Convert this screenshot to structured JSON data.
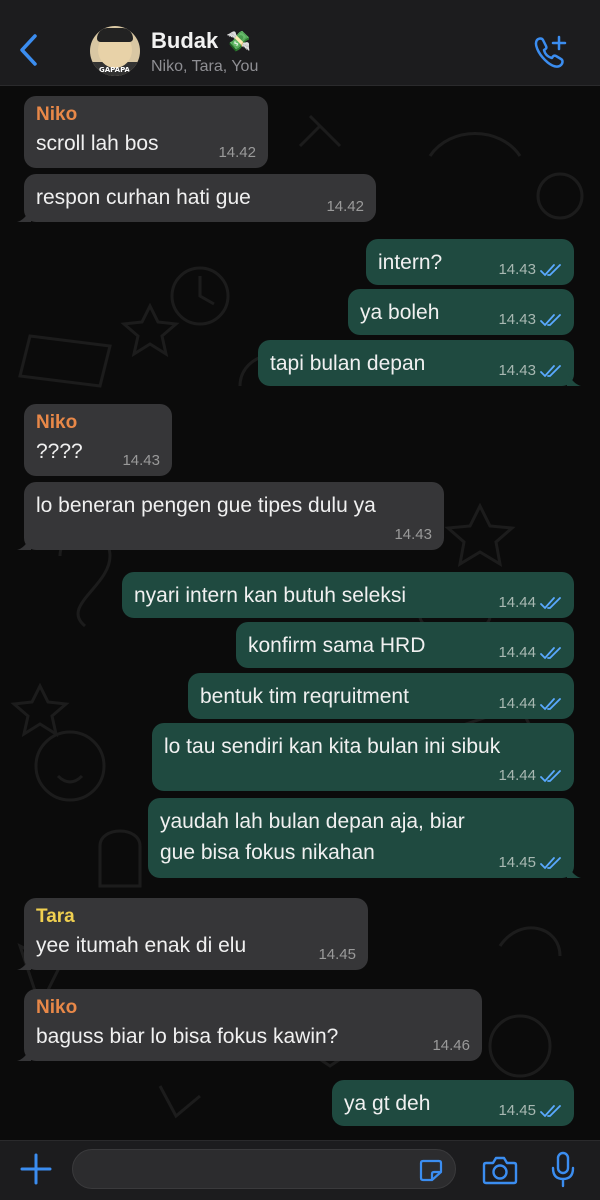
{
  "header": {
    "group_name": "Budak",
    "group_emoji": "💸",
    "members": "Niko, Tara, You",
    "avatar_tag": "GAPAPA"
  },
  "messages": [
    {
      "sender": "Niko",
      "text": "scroll lah bos",
      "time": "14.42",
      "direction": "in"
    },
    {
      "sender": "",
      "text": "respon curhan hati gue",
      "time": "14.42",
      "direction": "in"
    },
    {
      "sender": "",
      "text": "intern?",
      "time": "14.43",
      "direction": "out"
    },
    {
      "sender": "",
      "text": "ya boleh",
      "time": "14.43",
      "direction": "out"
    },
    {
      "sender": "",
      "text": "tapi bulan depan",
      "time": "14.43",
      "direction": "out"
    },
    {
      "sender": "Niko",
      "text": "????",
      "time": "14.43",
      "direction": "in"
    },
    {
      "sender": "",
      "text": "lo beneran pengen gue tipes dulu ya",
      "time": "14.43",
      "direction": "in"
    },
    {
      "sender": "",
      "text": "nyari intern kan butuh seleksi",
      "time": "14.44",
      "direction": "out"
    },
    {
      "sender": "",
      "text": "konfirm sama HRD",
      "time": "14.44",
      "direction": "out"
    },
    {
      "sender": "",
      "text": "bentuk tim reqruitment",
      "time": "14.44",
      "direction": "out"
    },
    {
      "sender": "",
      "text": "lo tau sendiri kan kita bulan ini sibuk",
      "time": "14.44",
      "direction": "out"
    },
    {
      "sender": "",
      "text": "yaudah lah bulan depan aja, biar gue bisa fokus nikahan",
      "time": "14.45",
      "direction": "out"
    },
    {
      "sender": "Tara",
      "text": "yee itumah enak di elu",
      "time": "14.45",
      "direction": "in"
    },
    {
      "sender": "Niko",
      "text": "baguss biar lo bisa fokus kawin?",
      "time": "14.46",
      "direction": "in"
    },
    {
      "sender": "",
      "text": "ya gt deh",
      "time": "14.45",
      "direction": "out"
    }
  ],
  "composer": {
    "value": "",
    "placeholder": ""
  },
  "colors": {
    "incoming_bubble": "#363638",
    "outgoing_bubble": "#1f4a40",
    "niko_name": "#e88848",
    "tara_name": "#f0d050",
    "read_tick": "#5aa9ff",
    "accent": "#3b8df0"
  },
  "icons": {
    "back": "chevron-left-icon",
    "call": "add-call-icon",
    "attach": "plus-icon",
    "sticker": "sticker-icon",
    "camera": "camera-icon",
    "mic": "microphone-icon",
    "read": "double-check-icon"
  }
}
